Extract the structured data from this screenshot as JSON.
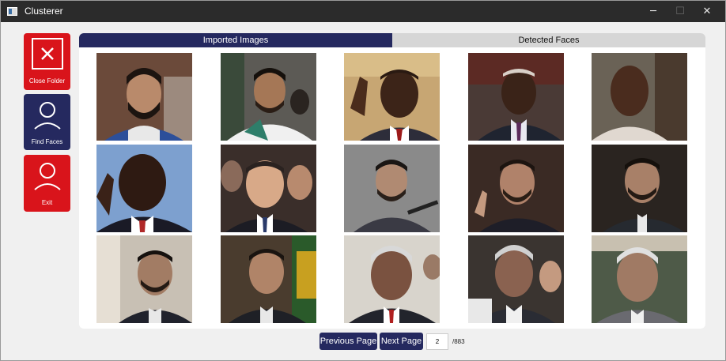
{
  "window": {
    "title": "Clusterer",
    "controls": {
      "minimize": "─",
      "maximize": "☐",
      "close": "✕"
    }
  },
  "sidebar": {
    "close_folder_label": "Close Folder",
    "find_faces_label": "Find Faces",
    "exit_label": "Exit"
  },
  "tabs": {
    "imported_label": "Imported Images",
    "detected_label": "Detected Faces",
    "active": "Imported Images"
  },
  "pager": {
    "previous_label": "Previous Page",
    "next_label": "Next Page",
    "current_page": "2",
    "total_pages": "/883"
  },
  "colors": {
    "accent_navy": "#25295f",
    "accent_red": "#d9141b",
    "titlebar": "#2b2b2b"
  }
}
